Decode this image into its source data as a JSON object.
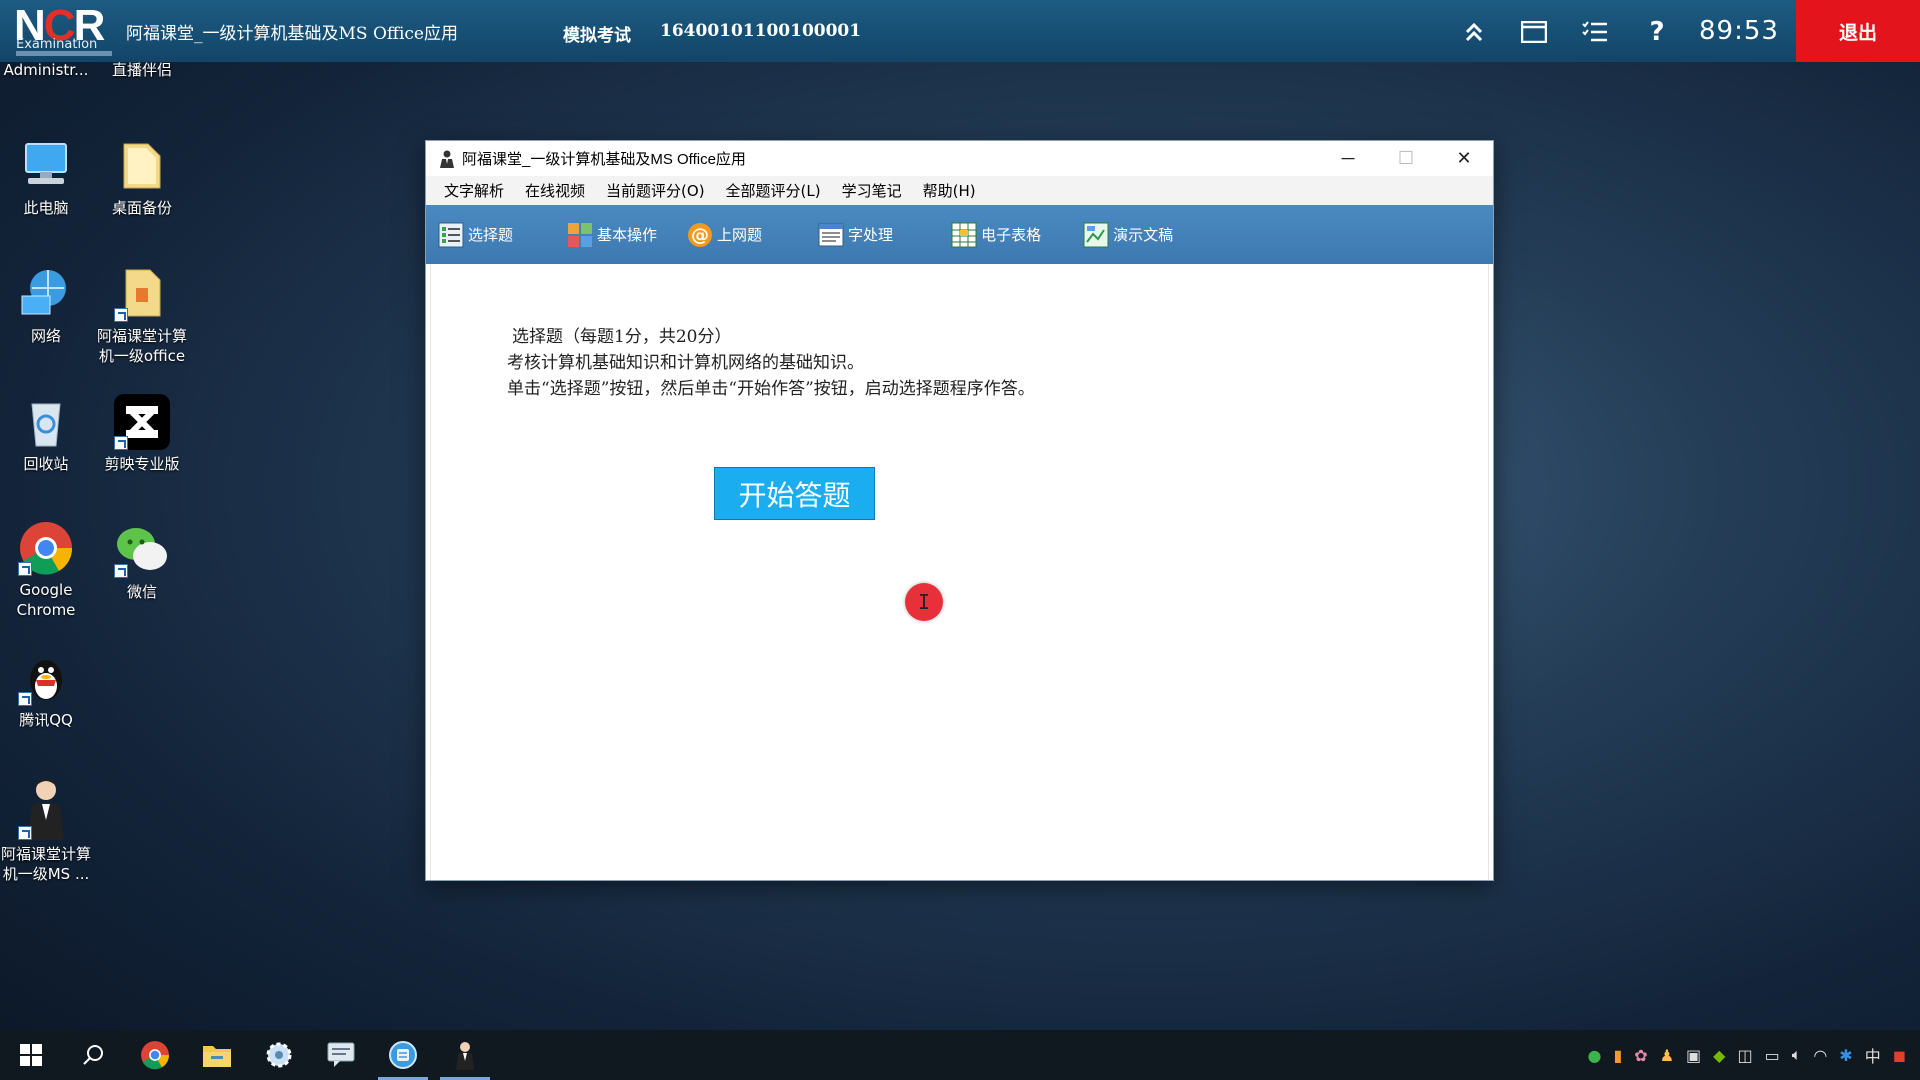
{
  "exam_bar": {
    "logo_text": "NCR",
    "logo_sub": "Examination",
    "title": "阿福课堂_一级计算机基础及MS Office应用",
    "mode": "模拟考试",
    "exam_id": "16400101100100001",
    "timer": "89:53",
    "exit_label": "退出",
    "icons": [
      "collapse-up-icon",
      "window-icon",
      "question-list-icon",
      "help-icon"
    ]
  },
  "desktop": {
    "icons": [
      {
        "label": "Administr...",
        "icon": "user-folder-icon"
      },
      {
        "label": "直播伴侣",
        "icon": "live-companion-icon"
      },
      {
        "label": "此电脑",
        "icon": "this-pc-icon"
      },
      {
        "label": "桌面备份",
        "icon": "folder-icon"
      },
      {
        "label": "网络",
        "icon": "network-icon"
      },
      {
        "label": "阿福课堂计算机一级office",
        "icon": "folder-doc-icon"
      },
      {
        "label": "回收站",
        "icon": "recycle-bin-icon"
      },
      {
        "label": "剪映专业版",
        "icon": "capcut-icon"
      },
      {
        "label": "Google Chrome",
        "icon": "chrome-icon"
      },
      {
        "label": "微信",
        "icon": "wechat-icon"
      },
      {
        "label": "腾讯QQ",
        "icon": "qq-icon"
      },
      {
        "label": "阿福课堂计算机一级MS ...",
        "icon": "teacher-avatar-icon"
      }
    ]
  },
  "window": {
    "title": "阿福课堂_一级计算机基础及MS Office应用",
    "controls": {
      "minimize": "─",
      "maximize": "☐",
      "close": "✕"
    },
    "menu": [
      "文字解析",
      "在线视频",
      "当前题评分(O)",
      "全部题评分(L)",
      "学习笔记",
      "帮助(H)"
    ],
    "toolbar": [
      {
        "label": "选择题",
        "icon": "choice-list-icon"
      },
      {
        "label": "基本操作",
        "icon": "basic-ops-icon"
      },
      {
        "label": "上网题",
        "icon": "at-sign-icon"
      },
      {
        "label": "字处理",
        "icon": "word-doc-icon"
      },
      {
        "label": "电子表格",
        "icon": "spreadsheet-icon"
      },
      {
        "label": "演示文稿",
        "icon": "presentation-icon"
      }
    ],
    "content": {
      "lines": [
        "选择题（每题1分，共20分）",
        "考核计算机基础知识和计算机网络的基础知识。",
        "单击“选择题”按钮，然后单击“开始作答”按钮，启动选择题程序作答。"
      ],
      "start_button": "开始答题",
      "cursor_glyph": "I"
    }
  },
  "taskbar": {
    "items": [
      "windows-start-icon",
      "search-icon",
      "chrome-icon",
      "file-explorer-icon",
      "settings-gear-icon",
      "chat-app-icon",
      "browser-e-icon",
      "teacher-app-icon"
    ],
    "tray_ime": "中"
  }
}
